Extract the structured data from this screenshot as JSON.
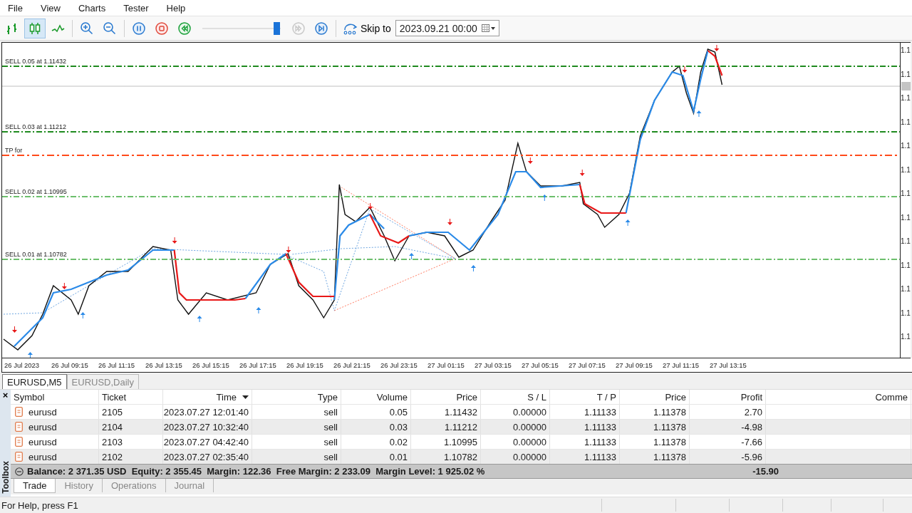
{
  "menu": [
    "File",
    "View",
    "Charts",
    "Tester",
    "Help"
  ],
  "toolbar": {
    "chart_types": [
      {
        "kind": "bars",
        "selected": false
      },
      {
        "kind": "candles",
        "selected": true
      },
      {
        "kind": "line",
        "selected": false
      }
    ],
    "speed_slider": {
      "level": 0.95
    },
    "fast_forward_disabled": true,
    "skip_label": "Skip to",
    "skip_date": "2023.09.21 00:00"
  },
  "chart": {
    "levels": [
      {
        "label": "SELL 0.05 at 1.11432",
        "kind": "sell",
        "color": "#1e8a1e"
      },
      {
        "label": "SELL 0.03 at 1.11212",
        "kind": "sell",
        "color": "#1e8a1e"
      },
      {
        "label": "TP for",
        "kind": "tp",
        "color": "#ff4a1a"
      },
      {
        "label": "SELL 0.02 at 1.10995",
        "kind": "sell",
        "color": "#6cbf6c"
      },
      {
        "label": "SELL 0.01 at 1.10782",
        "kind": "sell",
        "color": "#6cbf6c"
      }
    ],
    "price_axis": [
      "1.1",
      "1.1",
      "1.1",
      "1.1",
      "1.1",
      "1.1",
      "1.1",
      "1.1",
      "1.1",
      "1.1",
      "1.1",
      "1.1",
      "1.1"
    ],
    "time_axis": [
      "26 Jul 2023",
      "26 Jul 09:15",
      "26 Jul 11:15",
      "26 Jul 13:15",
      "26 Jul 15:15",
      "26 Jul 17:15",
      "26 Jul 19:15",
      "26 Jul 21:15",
      "26 Jul 23:15",
      "27 Jul 01:15",
      "27 Jul 03:15",
      "27 Jul 05:15",
      "27 Jul 07:15",
      "27 Jul 09:15",
      "27 Jul 11:15",
      "27 Jul 13:15"
    ]
  },
  "chart_tabs": [
    {
      "label": "EURUSD,M5",
      "selected": true
    },
    {
      "label": "EURUSD,Daily",
      "selected": false
    }
  ],
  "toolbox": {
    "close": "×",
    "title": "Toolbox",
    "columns": [
      {
        "label": "Symbol",
        "sorted": false
      },
      {
        "label": "Ticket",
        "sorted": false
      },
      {
        "label": "Time",
        "sorted": true
      },
      {
        "label": "Type",
        "sorted": false
      },
      {
        "label": "Volume",
        "sorted": false
      },
      {
        "label": "Price",
        "sorted": false
      },
      {
        "label": "S / L",
        "sorted": false
      },
      {
        "label": "T / P",
        "sorted": false
      },
      {
        "label": "Price",
        "sorted": false
      },
      {
        "label": "Profit",
        "sorted": false
      },
      {
        "label": "Comme",
        "sorted": false
      }
    ],
    "rows": [
      {
        "cells": [
          "eurusd",
          "2105",
          "2023.07.27 12:01:40",
          "sell",
          "0.05",
          "1.11432",
          "0.00000",
          "1.11133",
          "1.11378",
          "2.70"
        ]
      },
      {
        "cells": [
          "eurusd",
          "2104",
          "2023.07.27 10:32:40",
          "sell",
          "0.03",
          "1.11212",
          "0.00000",
          "1.11133",
          "1.11378",
          "-4.98"
        ]
      },
      {
        "cells": [
          "eurusd",
          "2103",
          "2023.07.27 04:42:40",
          "sell",
          "0.02",
          "1.10995",
          "0.00000",
          "1.11133",
          "1.11378",
          "-7.66"
        ]
      },
      {
        "cells": [
          "eurusd",
          "2102",
          "2023.07.27 02:35:40",
          "sell",
          "0.01",
          "1.10782",
          "0.00000",
          "1.11133",
          "1.11378",
          "-5.96"
        ]
      }
    ],
    "summary": {
      "text": "Balance: 2 371.35 USD  Equity: 2 355.45  Margin: 122.36  Free Margin: 2 233.09  Margin Level: 1 925.02 %",
      "profit": "-15.90"
    },
    "tabs": [
      {
        "label": "Trade",
        "selected": true
      },
      {
        "label": "History",
        "selected": false
      },
      {
        "label": "Operations",
        "selected": false
      },
      {
        "label": "Journal",
        "selected": false
      }
    ]
  },
  "status_bar": {
    "text": "For Help, press F1"
  }
}
